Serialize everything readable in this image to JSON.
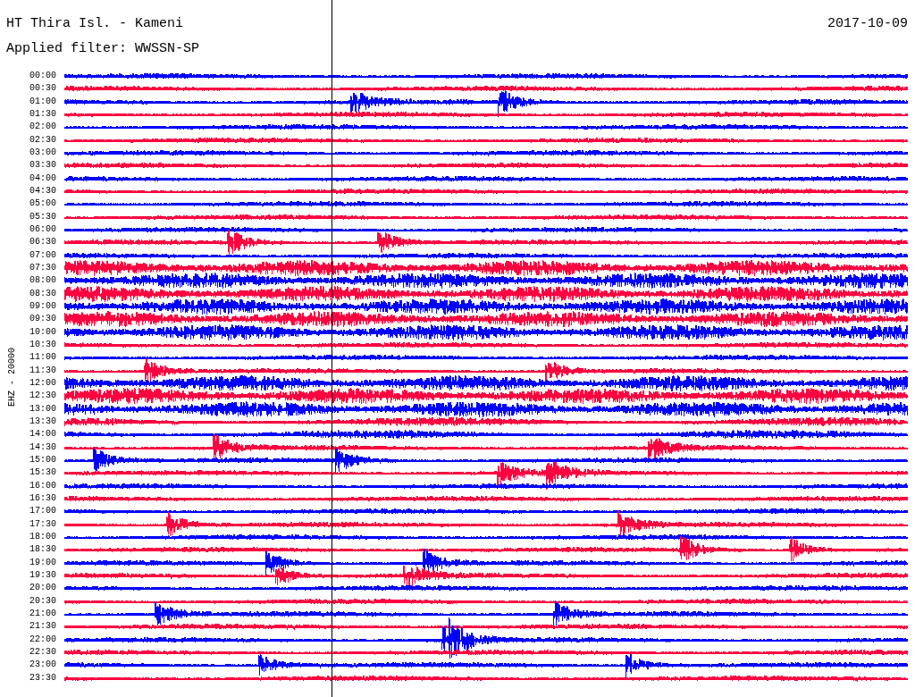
{
  "header": {
    "station": "HT Thira Isl. - Kameni",
    "date": "2017-10-09",
    "filter": "Applied filter: WWSSN-SP"
  },
  "channel": "EHZ - 20000",
  "traces": [
    {
      "label": "00:00",
      "color": "#0000ff",
      "kind": "quiet"
    },
    {
      "label": "00:30",
      "color": "#ff0040",
      "kind": "quiet"
    },
    {
      "label": "01:00",
      "color": "#0000ff",
      "kind": "event"
    },
    {
      "label": "01:30",
      "color": "#ff0040",
      "kind": "quiet"
    },
    {
      "label": "02:00",
      "color": "#0000ff",
      "kind": "quiet"
    },
    {
      "label": "02:30",
      "color": "#ff0040",
      "kind": "quiet"
    },
    {
      "label": "03:00",
      "color": "#0000ff",
      "kind": "quiet"
    },
    {
      "label": "03:30",
      "color": "#ff0040",
      "kind": "quiet"
    },
    {
      "label": "04:00",
      "color": "#0000ff",
      "kind": "quiet"
    },
    {
      "label": "04:30",
      "color": "#ff0040",
      "kind": "quiet"
    },
    {
      "label": "05:00",
      "color": "#0000ff",
      "kind": "quiet"
    },
    {
      "label": "05:30",
      "color": "#ff0040",
      "kind": "quiet"
    },
    {
      "label": "06:00",
      "color": "#0000ff",
      "kind": "quiet"
    },
    {
      "label": "06:30",
      "color": "#ff0040",
      "kind": "event"
    },
    {
      "label": "07:00",
      "color": "#0000ff",
      "kind": "quiet"
    },
    {
      "label": "07:30",
      "color": "#ff0040",
      "kind": "noisy"
    },
    {
      "label": "08:00",
      "color": "#0000ff",
      "kind": "noisy"
    },
    {
      "label": "08:30",
      "color": "#ff0040",
      "kind": "noisy"
    },
    {
      "label": "09:00",
      "color": "#0000ff",
      "kind": "noisy"
    },
    {
      "label": "09:30",
      "color": "#ff0040",
      "kind": "noisy"
    },
    {
      "label": "10:00",
      "color": "#0000ff",
      "kind": "noisy"
    },
    {
      "label": "10:30",
      "color": "#ff0040",
      "kind": "quiet"
    },
    {
      "label": "11:00",
      "color": "#0000ff",
      "kind": "quiet"
    },
    {
      "label": "11:30",
      "color": "#ff0040",
      "kind": "event"
    },
    {
      "label": "12:00",
      "color": "#0000ff",
      "kind": "noisy"
    },
    {
      "label": "12:30",
      "color": "#ff0040",
      "kind": "noisy"
    },
    {
      "label": "13:00",
      "color": "#0000ff",
      "kind": "noisy"
    },
    {
      "label": "13:30",
      "color": "#ff0040",
      "kind": "medium"
    },
    {
      "label": "14:00",
      "color": "#0000ff",
      "kind": "medium"
    },
    {
      "label": "14:30",
      "color": "#ff0040",
      "kind": "event"
    },
    {
      "label": "15:00",
      "color": "#0000ff",
      "kind": "event"
    },
    {
      "label": "15:30",
      "color": "#ff0040",
      "kind": "event"
    },
    {
      "label": "16:00",
      "color": "#0000ff",
      "kind": "quiet"
    },
    {
      "label": "16:30",
      "color": "#ff0040",
      "kind": "quiet"
    },
    {
      "label": "17:00",
      "color": "#0000ff",
      "kind": "quiet"
    },
    {
      "label": "17:30",
      "color": "#ff0040",
      "kind": "event"
    },
    {
      "label": "18:00",
      "color": "#0000ff",
      "kind": "quiet"
    },
    {
      "label": "18:30",
      "color": "#ff0040",
      "kind": "event"
    },
    {
      "label": "19:00",
      "color": "#0000ff",
      "kind": "event"
    },
    {
      "label": "19:30",
      "color": "#ff0040",
      "kind": "event"
    },
    {
      "label": "20:00",
      "color": "#0000ff",
      "kind": "quiet"
    },
    {
      "label": "20:30",
      "color": "#ff0040",
      "kind": "quiet"
    },
    {
      "label": "21:00",
      "color": "#0000ff",
      "kind": "event"
    },
    {
      "label": "21:30",
      "color": "#ff0040",
      "kind": "quiet"
    },
    {
      "label": "22:00",
      "color": "#0000ff",
      "kind": "event"
    },
    {
      "label": "22:30",
      "color": "#ff0040",
      "kind": "quiet"
    },
    {
      "label": "23:00",
      "color": "#0000ff",
      "kind": "event"
    },
    {
      "label": "23:30",
      "color": "#ff0040",
      "kind": "quiet"
    }
  ]
}
